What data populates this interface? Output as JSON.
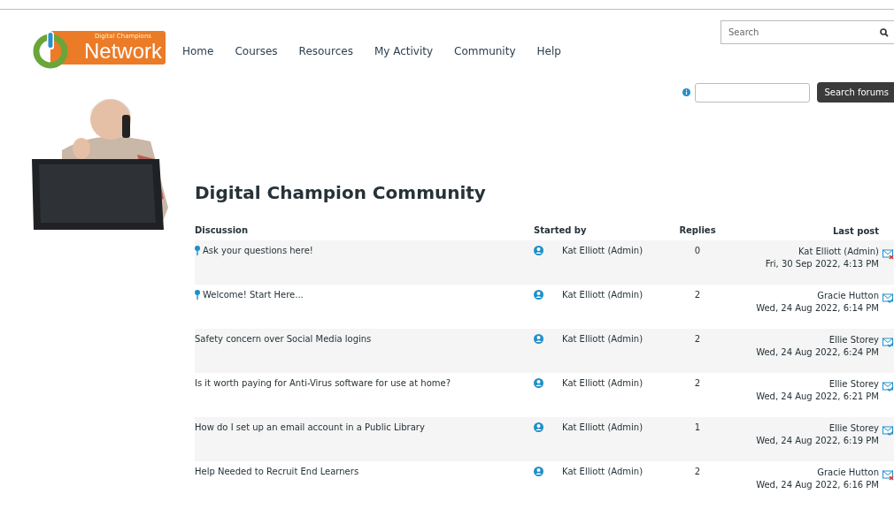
{
  "logo": {
    "small": "Digital Champions",
    "big": "Network"
  },
  "nav": [
    "Home",
    "Courses",
    "Resources",
    "My Activity",
    "Community",
    "Help"
  ],
  "search": {
    "placeholder": "Search"
  },
  "forum_search": {
    "button": "Search forums"
  },
  "title": "Digital Champion Community",
  "table": {
    "columns": [
      "Discussion",
      "Started by",
      "Replies",
      "Last post"
    ],
    "rows": [
      {
        "discussion": "Ask your questions here!",
        "pinned": true,
        "started_by": "Kat Elliott (Admin)",
        "replies": "0",
        "last_author": "Kat Elliott (Admin)",
        "last_date": "Fri, 30 Sep 2022, 4:13 PM",
        "subscribed": false
      },
      {
        "discussion": "Welcome! Start Here...",
        "pinned": true,
        "started_by": "Kat Elliott (Admin)",
        "replies": "2",
        "last_author": "Gracie Hutton",
        "last_date": "Wed, 24 Aug 2022, 6:14 PM",
        "subscribed": true
      },
      {
        "discussion": "Safety concern over Social Media logins",
        "pinned": false,
        "started_by": "Kat Elliott (Admin)",
        "replies": "2",
        "last_author": "Ellie Storey",
        "last_date": "Wed, 24 Aug 2022, 6:24 PM",
        "subscribed": true
      },
      {
        "discussion": "Is it worth paying for Anti-Virus software for use at home?",
        "pinned": false,
        "started_by": "Kat Elliott (Admin)",
        "replies": "2",
        "last_author": "Ellie Storey",
        "last_date": "Wed, 24 Aug 2022, 6:21 PM",
        "subscribed": true
      },
      {
        "discussion": "How do I set up an email account in a Public Library",
        "pinned": false,
        "started_by": "Kat Elliott (Admin)",
        "replies": "1",
        "last_author": "Ellie Storey",
        "last_date": "Wed, 24 Aug 2022, 6:19 PM",
        "subscribed": true
      },
      {
        "discussion": "Help Needed to Recruit End Learners",
        "pinned": false,
        "started_by": "Kat Elliott (Admin)",
        "replies": "2",
        "last_author": "Gracie Hutton",
        "last_date": "Wed, 24 Aug 2022, 6:16 PM",
        "subscribed": false
      }
    ]
  }
}
